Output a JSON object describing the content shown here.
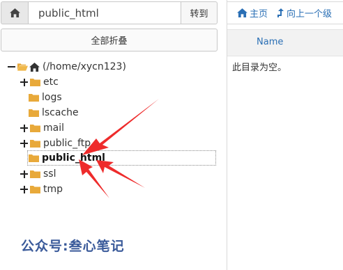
{
  "pathbar": {
    "value": "public_html",
    "goto_label": "转到"
  },
  "collapse_label": "全部折叠",
  "tree": {
    "root_label": "(/home/xycn123)",
    "items": [
      {
        "label": "etc",
        "expandable": true
      },
      {
        "label": "logs",
        "expandable": false
      },
      {
        "label": "lscache",
        "expandable": false
      },
      {
        "label": "mail",
        "expandable": true
      },
      {
        "label": "public_ftp",
        "expandable": true
      },
      {
        "label": "public_html",
        "expandable": false,
        "selected": true
      },
      {
        "label": "ssl",
        "expandable": true
      },
      {
        "label": "tmp",
        "expandable": true
      }
    ]
  },
  "watermark": "公众号:叁心笔记",
  "toolbar": {
    "home_label": "主页",
    "up_label": "向上一个级"
  },
  "table": {
    "name_header": "Name",
    "empty_message": "此目录为空。"
  },
  "colors": {
    "folder": "#e8a93a",
    "link": "#2a6fb5",
    "arrow": "#ee2b2b"
  },
  "icons": [
    "home-icon",
    "folder-open-icon",
    "folder-icon",
    "plus-icon",
    "minus-icon",
    "level-up-icon"
  ]
}
